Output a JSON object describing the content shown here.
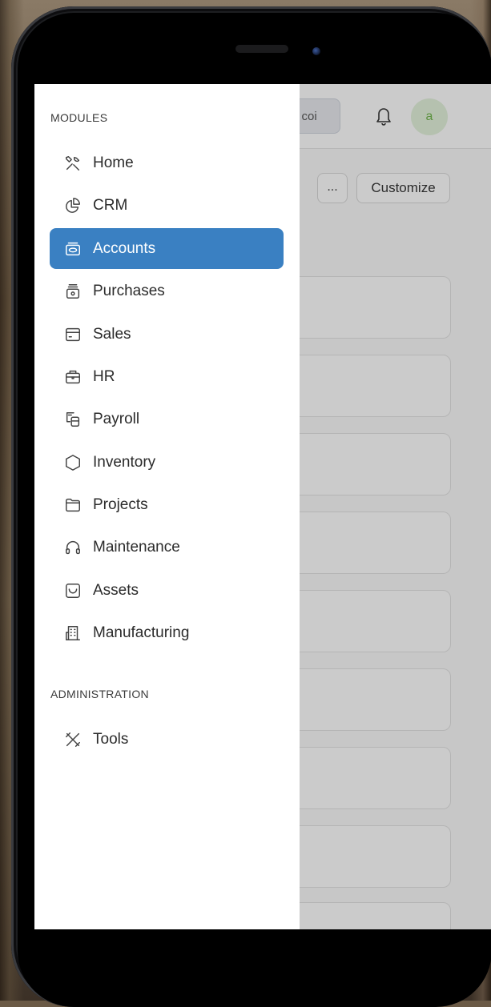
{
  "topbar": {
    "search_text": "a coi",
    "avatar_initial": "a"
  },
  "page": {
    "more_label": "...",
    "customize_label": "Customize"
  },
  "drawer": {
    "modules_heading": "MODULES",
    "modules": [
      {
        "label": "Home",
        "icon": "tools-icon",
        "active": false
      },
      {
        "label": "CRM",
        "icon": "pie-chart-icon",
        "active": false
      },
      {
        "label": "Accounts",
        "icon": "wallet-icon",
        "active": true
      },
      {
        "label": "Purchases",
        "icon": "cash-register-icon",
        "active": false
      },
      {
        "label": "Sales",
        "icon": "card-icon",
        "active": false
      },
      {
        "label": "HR",
        "icon": "briefcase-icon",
        "active": false
      },
      {
        "label": "Payroll",
        "icon": "money-icon",
        "active": false
      },
      {
        "label": "Inventory",
        "icon": "hexagon-icon",
        "active": false
      },
      {
        "label": "Projects",
        "icon": "folder-icon",
        "active": false
      },
      {
        "label": "Maintenance",
        "icon": "headset-icon",
        "active": false
      },
      {
        "label": "Assets",
        "icon": "box-icon",
        "active": false
      },
      {
        "label": "Manufacturing",
        "icon": "building-icon",
        "active": false
      }
    ],
    "admin_heading": "ADMINISTRATION",
    "admin": [
      {
        "label": "Tools",
        "icon": "tools-icon",
        "active": false
      }
    ]
  },
  "colors": {
    "accent": "#3a80c2"
  }
}
